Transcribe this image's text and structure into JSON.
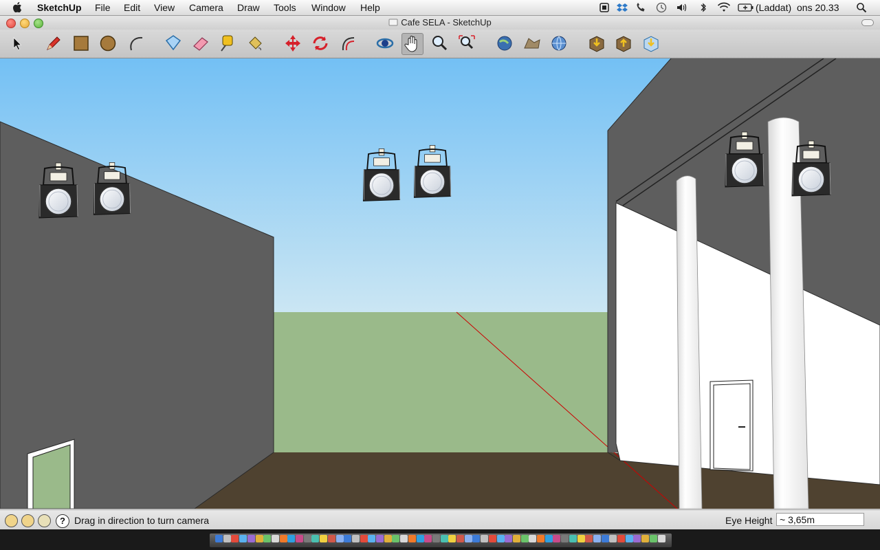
{
  "menubar": {
    "app_name": "SketchUp",
    "items": [
      "File",
      "Edit",
      "View",
      "Camera",
      "Draw",
      "Tools",
      "Window",
      "Help"
    ],
    "battery_text": "(Laddat)",
    "clock": "ons 20.33"
  },
  "window": {
    "title": "Cafe SELA - SketchUp"
  },
  "toolbar": {
    "tools": [
      "select-tool",
      "pencil-tool",
      "rectangle-tool",
      "circle-tool",
      "arc-tool",
      "make-component-tool",
      "eraser-tool",
      "tape-measure-tool",
      "paint-bucket-tool",
      "move-tool",
      "rotate-tool",
      "offset-tool",
      "orbit-tool",
      "pan-tool",
      "zoom-tool",
      "zoom-extents-tool",
      "get-models-tool",
      "share-model-tool",
      "share-component-tool",
      "send-to-layout-tool",
      "preview-in-google-earth-tool",
      "warehouse-tool"
    ]
  },
  "statusbar": {
    "message": "Drag in direction to turn camera",
    "vcb_label": "Eye Height",
    "vcb_value": "~ 3,65m"
  },
  "colors": {
    "sky_top": "#7bc4f5",
    "sky_horizon": "#c7e4f3",
    "ground": "#9aba8a",
    "floor": "#4f4230",
    "wall_gray": "#5e5e5e",
    "wall_white": "#ffffff",
    "red_axis": "#cc0000"
  }
}
